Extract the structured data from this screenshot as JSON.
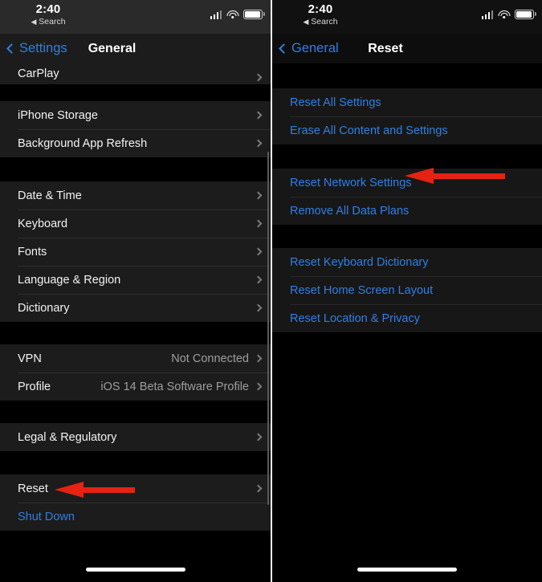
{
  "status_bar": {
    "time": "2:40",
    "back_label": "Search",
    "back_triangle": "◀",
    "signal_icon": "cellular-bars-icon",
    "wifi_icon": "wifi-icon",
    "battery_icon": "battery-icon"
  },
  "colors": {
    "accent_blue": "#2f7fe4",
    "arrow_red": "#e62212",
    "row_background": "#1c1c1c",
    "page_background": "#000000",
    "primary_text": "#f2f2f2",
    "secondary_text": "#9d9d9d"
  },
  "left_panel": {
    "nav": {
      "back_label": "Settings",
      "title": "General"
    },
    "groups": [
      {
        "rows": [
          {
            "label": "CarPlay",
            "value": "",
            "chevron": true,
            "style": "default",
            "clipped": true
          }
        ]
      },
      {
        "rows": [
          {
            "label": "iPhone Storage",
            "value": "",
            "chevron": true,
            "style": "default"
          },
          {
            "label": "Background App Refresh",
            "value": "",
            "chevron": true,
            "style": "default"
          }
        ]
      },
      {
        "rows": [
          {
            "label": "Date & Time",
            "value": "",
            "chevron": true,
            "style": "default"
          },
          {
            "label": "Keyboard",
            "value": "",
            "chevron": true,
            "style": "default"
          },
          {
            "label": "Fonts",
            "value": "",
            "chevron": true,
            "style": "default"
          },
          {
            "label": "Language & Region",
            "value": "",
            "chevron": true,
            "style": "default"
          },
          {
            "label": "Dictionary",
            "value": "",
            "chevron": true,
            "style": "default"
          }
        ]
      },
      {
        "rows": [
          {
            "label": "VPN",
            "value": "Not Connected",
            "chevron": true,
            "style": "default"
          },
          {
            "label": "Profile",
            "value": "iOS 14 Beta Software Profile",
            "chevron": true,
            "style": "default"
          }
        ]
      },
      {
        "rows": [
          {
            "label": "Legal & Regulatory",
            "value": "",
            "chevron": true,
            "style": "default"
          }
        ]
      },
      {
        "rows": [
          {
            "label": "Reset",
            "value": "",
            "chevron": true,
            "style": "default"
          },
          {
            "label": "Shut Down",
            "value": "",
            "chevron": false,
            "style": "link"
          }
        ]
      }
    ],
    "annotation": {
      "icon": "red-arrow-icon",
      "points_at": "Reset"
    }
  },
  "right_panel": {
    "nav": {
      "back_label": "General",
      "title": "Reset"
    },
    "groups": [
      {
        "rows": [
          {
            "label": "Reset All Settings",
            "value": "",
            "chevron": false,
            "style": "link"
          },
          {
            "label": "Erase All Content and Settings",
            "value": "",
            "chevron": false,
            "style": "link"
          }
        ]
      },
      {
        "rows": [
          {
            "label": "Reset Network Settings",
            "value": "",
            "chevron": false,
            "style": "link"
          },
          {
            "label": "Remove All Data Plans",
            "value": "",
            "chevron": false,
            "style": "link"
          }
        ]
      },
      {
        "rows": [
          {
            "label": "Reset Keyboard Dictionary",
            "value": "",
            "chevron": false,
            "style": "link"
          },
          {
            "label": "Reset Home Screen Layout",
            "value": "",
            "chevron": false,
            "style": "link"
          },
          {
            "label": "Reset Location & Privacy",
            "value": "",
            "chevron": false,
            "style": "link"
          }
        ]
      }
    ],
    "annotation": {
      "icon": "red-arrow-icon",
      "points_at": "Reset Network Settings"
    }
  }
}
